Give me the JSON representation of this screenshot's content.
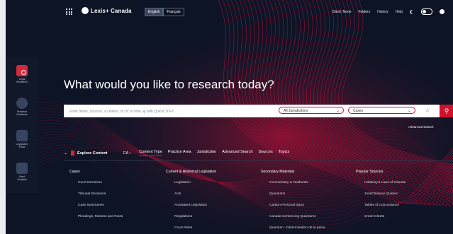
{
  "brand": {
    "name": "Lexis+ Canada"
  },
  "languages": [
    {
      "label": "English",
      "active": true
    },
    {
      "label": "Français",
      "active": false
    }
  ],
  "topnav": [
    "Client: None",
    "Folders",
    "History",
    "Help"
  ],
  "rail": [
    {
      "label": "Legal\nResearch",
      "icon": "legal-research-icon",
      "active": true
    },
    {
      "label": "Practical\nGuidance",
      "icon": "practical-guidance-icon",
      "active": false
    },
    {
      "label": "Legislative\nPulse",
      "icon": "legislative-pulse-icon",
      "active": false
    },
    {
      "label": "Brief\nAnalysis",
      "icon": "brief-analysis-icon",
      "active": false
    }
  ],
  "main": {
    "heading": "What would you like to research today?",
    "search_placeholder": "Enter terms, sources, a citation, or cit: to note up with QuickCITE®",
    "jurisdiction_select": "All Jurisdictions",
    "type_select": "Cases",
    "advanced_search": "Advanced Search"
  },
  "explore": {
    "title": "Explore Content",
    "region": "CA",
    "tabs": [
      {
        "label": "Content Type",
        "active": true
      },
      {
        "label": "Practice Area",
        "active": false
      },
      {
        "label": "Jurisdiction",
        "active": false
      },
      {
        "label": "Advanced Search",
        "active": false
      },
      {
        "label": "Sources",
        "active": false
      },
      {
        "label": "Topics",
        "active": false
      }
    ]
  },
  "columns": [
    {
      "heading": "Cases",
      "items": [
        "Court Decisions",
        "Tribunal Decisions",
        "Case Summaries",
        "Pleadings, Motions and Facta"
      ]
    },
    {
      "heading": "Current & Historical Legislation",
      "items": [
        "Legislation",
        "Acts",
        "Annotated Legislation",
        "Regulations",
        "Court Rules"
      ]
    },
    {
      "heading": "Secondary Materials",
      "items": [
        "Commentary & Textbooks",
        "Quantums",
        "Carbon Personal Injury",
        "Canada Sentencing Quantums",
        "Quantum - Détermination de la peine"
      ]
    },
    {
      "heading": "Popular Sources",
      "items": [
        "Halsbury's Laws of Canada",
        "JurisClasseur Québec",
        "Tables of Concordance",
        "Smart Charts"
      ]
    }
  ],
  "colors": {
    "accent": "#d22a3a",
    "background": "#0d1426",
    "search_button": "#d0112b"
  }
}
